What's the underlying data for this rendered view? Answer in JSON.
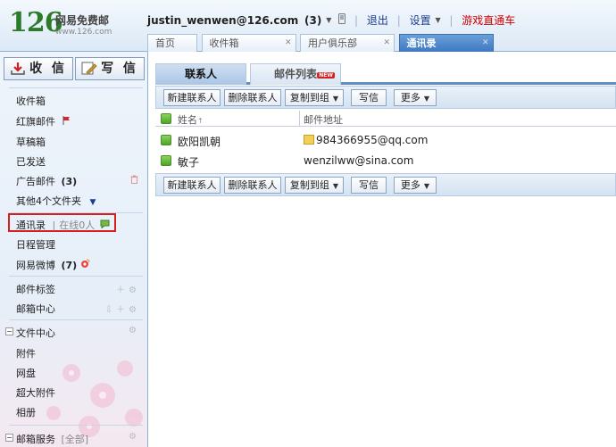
{
  "brand": {
    "logo_num": "126",
    "title": "网易免费邮",
    "url": "www.126.com"
  },
  "userbar": {
    "account": "justin_wenwen@126.com",
    "count": "(3)",
    "logout": "退出",
    "settings": "设置",
    "game": "游戏直通车"
  },
  "tabs": [
    {
      "label": "首页"
    },
    {
      "label": "收件箱"
    },
    {
      "label": "用户俱乐部"
    },
    {
      "label": "通讯录"
    }
  ],
  "sidebar": {
    "receive_label": "收 信",
    "write_label": "写 信",
    "folders": {
      "inbox": "收件箱",
      "flagged": "红旗邮件",
      "drafts": "草稿箱",
      "sent": "已发送",
      "ads": "广告邮件",
      "ads_count": "(3)",
      "other": "其他4个文件夹"
    },
    "contacts": "通讯录",
    "online": "在线0人",
    "calendar": "日程管理",
    "weibo": "网易微博",
    "weibo_count": "(7)",
    "tags": "邮件标签",
    "center": "邮箱中心",
    "file_center": "文件中心",
    "attachments": "附件",
    "netdisk": "网盘",
    "big_attach": "超大附件",
    "album": "相册",
    "services": "邮箱服务",
    "services_all": "[全部]"
  },
  "main": {
    "tab_contacts": "联系人",
    "tab_mailing": "邮件列表",
    "new_badge": "NEW",
    "toolbar": {
      "new_contact": "新建联系人",
      "delete_contact": "删除联系人",
      "copy_group": "复制到组",
      "write": "写信",
      "more": "更多"
    },
    "columns": {
      "name": "姓名",
      "email": "邮件地址"
    },
    "contacts": [
      {
        "name": "欧阳凯朝",
        "email": "984366955@qq.com"
      },
      {
        "name": "敏子",
        "email": "wenzilww@sina.com"
      }
    ]
  },
  "colors": {
    "accent": "#5d8ec8",
    "brand_green": "#2d7a2a",
    "highlight_red": "#d62020"
  }
}
